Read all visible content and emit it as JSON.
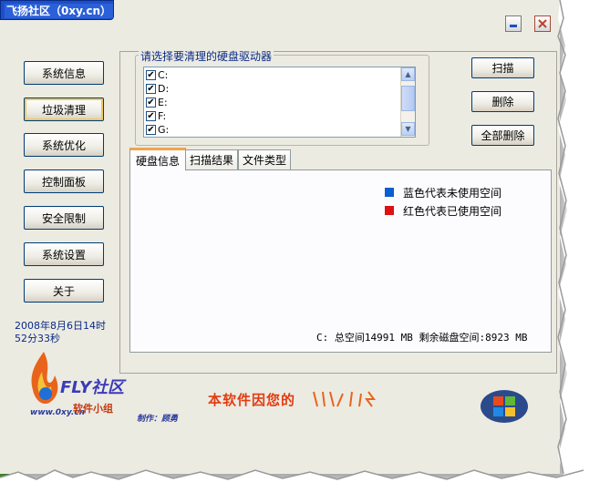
{
  "window": {
    "title": "飞扬社区（0xy.cn）"
  },
  "nav": {
    "items": [
      {
        "label": "系统信息"
      },
      {
        "label": "垃圾清理"
      },
      {
        "label": "系统优化"
      },
      {
        "label": "控制面板"
      },
      {
        "label": "安全限制"
      },
      {
        "label": "系统设置"
      },
      {
        "label": "关于"
      }
    ],
    "active_index": 1
  },
  "datetime": {
    "line1": "2008年8月6日14时",
    "line2": "52分33秒"
  },
  "drives": {
    "group_label": "请选择要清理的硬盘驱动器",
    "items": [
      {
        "label": "C:",
        "checked": true
      },
      {
        "label": "D:",
        "checked": true
      },
      {
        "label": "E:",
        "checked": true
      },
      {
        "label": "F:",
        "checked": true
      },
      {
        "label": "G:",
        "checked": true
      }
    ]
  },
  "actions": {
    "scan": "扫描",
    "delete": "删除",
    "delete_all": "全部删除"
  },
  "tabs": [
    {
      "label": "硬盘信息"
    },
    {
      "label": "扫描结果"
    },
    {
      "label": "文件类型"
    }
  ],
  "disk_info": {
    "legend_unused": "蓝色代表未使用空间",
    "legend_used": "红色代表已使用空间",
    "summary": "C: 总空间14991 MB 剩余磁盘空间:8923 MB"
  },
  "footer": {
    "logo_text": "FLY社区",
    "logo_site": "www.0xy.cn",
    "logo_group": "软件小组",
    "maker": "制作：顾勇",
    "slogan": "本软件因您的"
  },
  "colors": {
    "blue_legend": "#0a5fd0",
    "red_legend": "#e01010",
    "title_bar": "#1d4fc6",
    "accent_tab": "#f0a54a"
  }
}
